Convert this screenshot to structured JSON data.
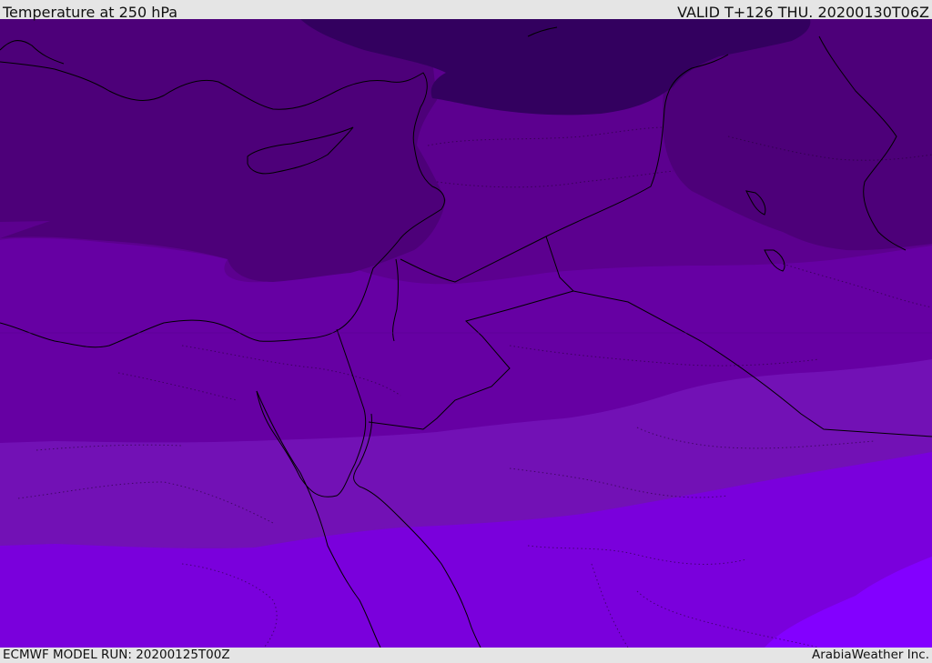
{
  "header": {
    "title": "Temperature at 250 hPa",
    "valid_time": "VALID T+126 THU. 20200130T06Z"
  },
  "footer": {
    "model_run": "ECMWF MODEL RUN: 20200125T00Z",
    "credit": "ArabiaWeather Inc."
  },
  "map": {
    "region": "Eastern Mediterranean / Levant / Egypt / Arabia",
    "colors": {
      "band1_darkest": "#33005f",
      "band2": "#4d0079",
      "band3": "#5c008f",
      "band4": "#6600a3",
      "band5": "#7211b5",
      "band6": "#7a00dc",
      "band7_lightest": "#8300ff",
      "coastline": "#000000"
    }
  }
}
